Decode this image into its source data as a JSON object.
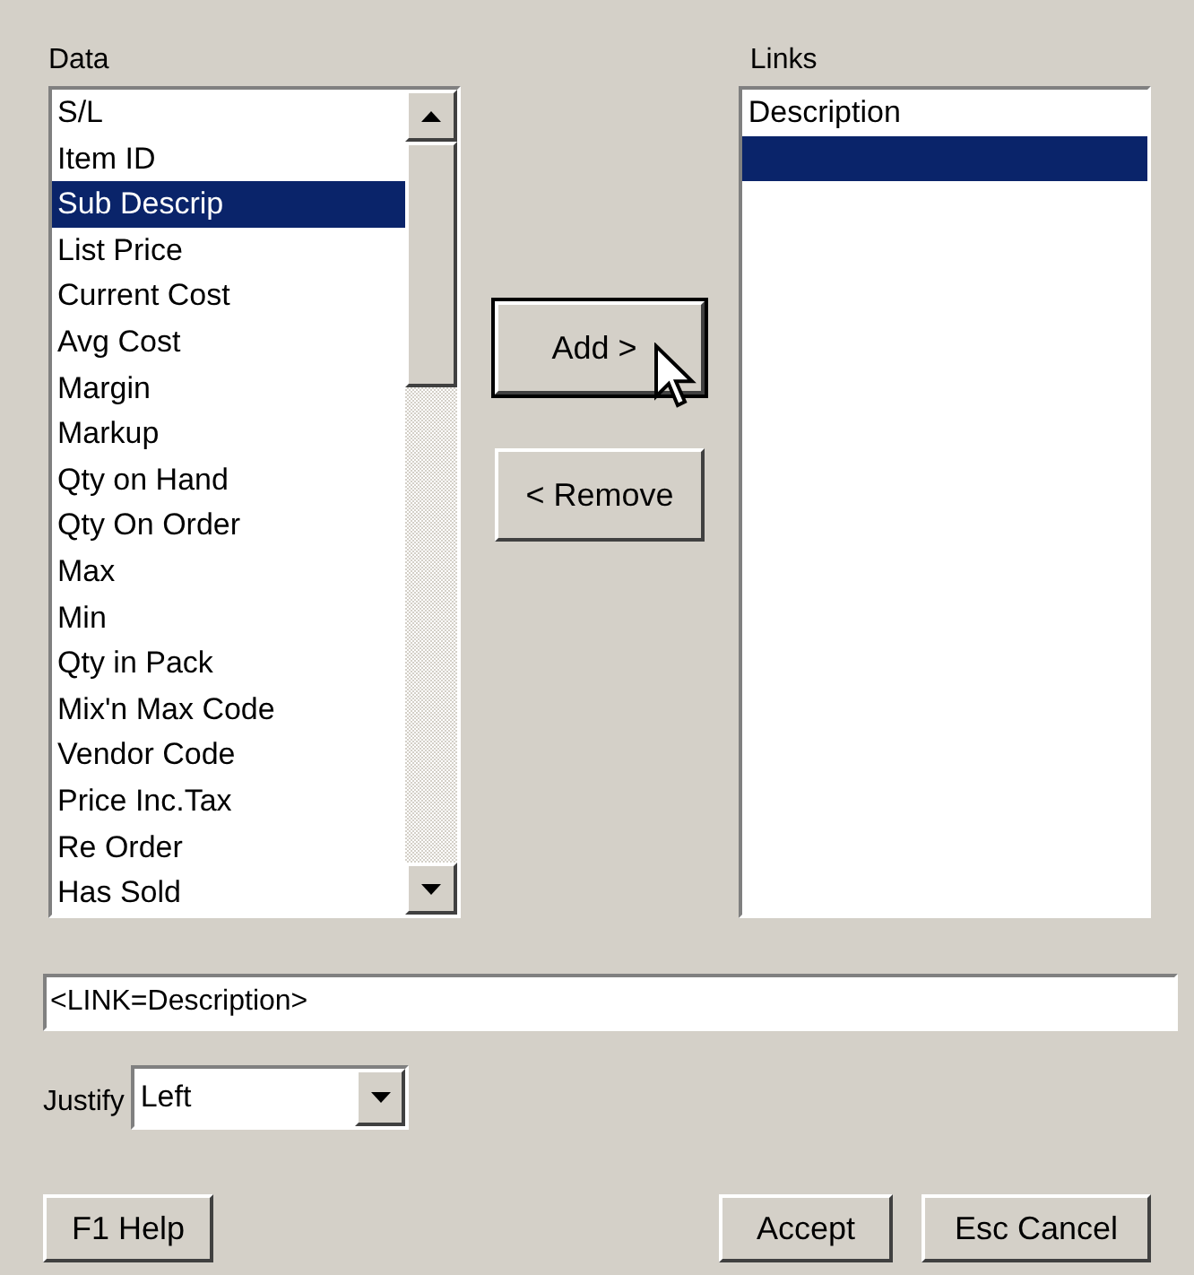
{
  "data_list": {
    "label": "Data",
    "items": [
      {
        "label": "S/L",
        "selected": false
      },
      {
        "label": "Item ID",
        "selected": false
      },
      {
        "label": "Sub Descrip",
        "selected": true
      },
      {
        "label": "List Price",
        "selected": false
      },
      {
        "label": "Current Cost",
        "selected": false
      },
      {
        "label": "Avg Cost",
        "selected": false
      },
      {
        "label": "Margin",
        "selected": false
      },
      {
        "label": "Markup",
        "selected": false
      },
      {
        "label": "Qty on Hand",
        "selected": false
      },
      {
        "label": "Qty On Order",
        "selected": false
      },
      {
        "label": "Max",
        "selected": false
      },
      {
        "label": "Min",
        "selected": false
      },
      {
        "label": "Qty in Pack",
        "selected": false
      },
      {
        "label": "Mix'n Max Code",
        "selected": false
      },
      {
        "label": "Vendor Code",
        "selected": false
      },
      {
        "label": "Price Inc.Tax",
        "selected": false
      },
      {
        "label": "Re Order",
        "selected": false
      },
      {
        "label": "Has Sold",
        "selected": false
      }
    ]
  },
  "add_button": {
    "label": "Add >",
    "default": true
  },
  "remove_button": {
    "label": "< Remove",
    "default": false
  },
  "links_list": {
    "label": "Links",
    "items": [
      {
        "label": "Description",
        "selected": false
      },
      {
        "selected": true
      }
    ]
  },
  "link_field": {
    "value": "<LINK=Description>"
  },
  "justify": {
    "label": "Justify",
    "value": "Left"
  },
  "buttons": [
    {
      "label": "F1 Help"
    },
    {
      "label": "Accept"
    },
    {
      "label": "Esc Cancel"
    }
  ]
}
